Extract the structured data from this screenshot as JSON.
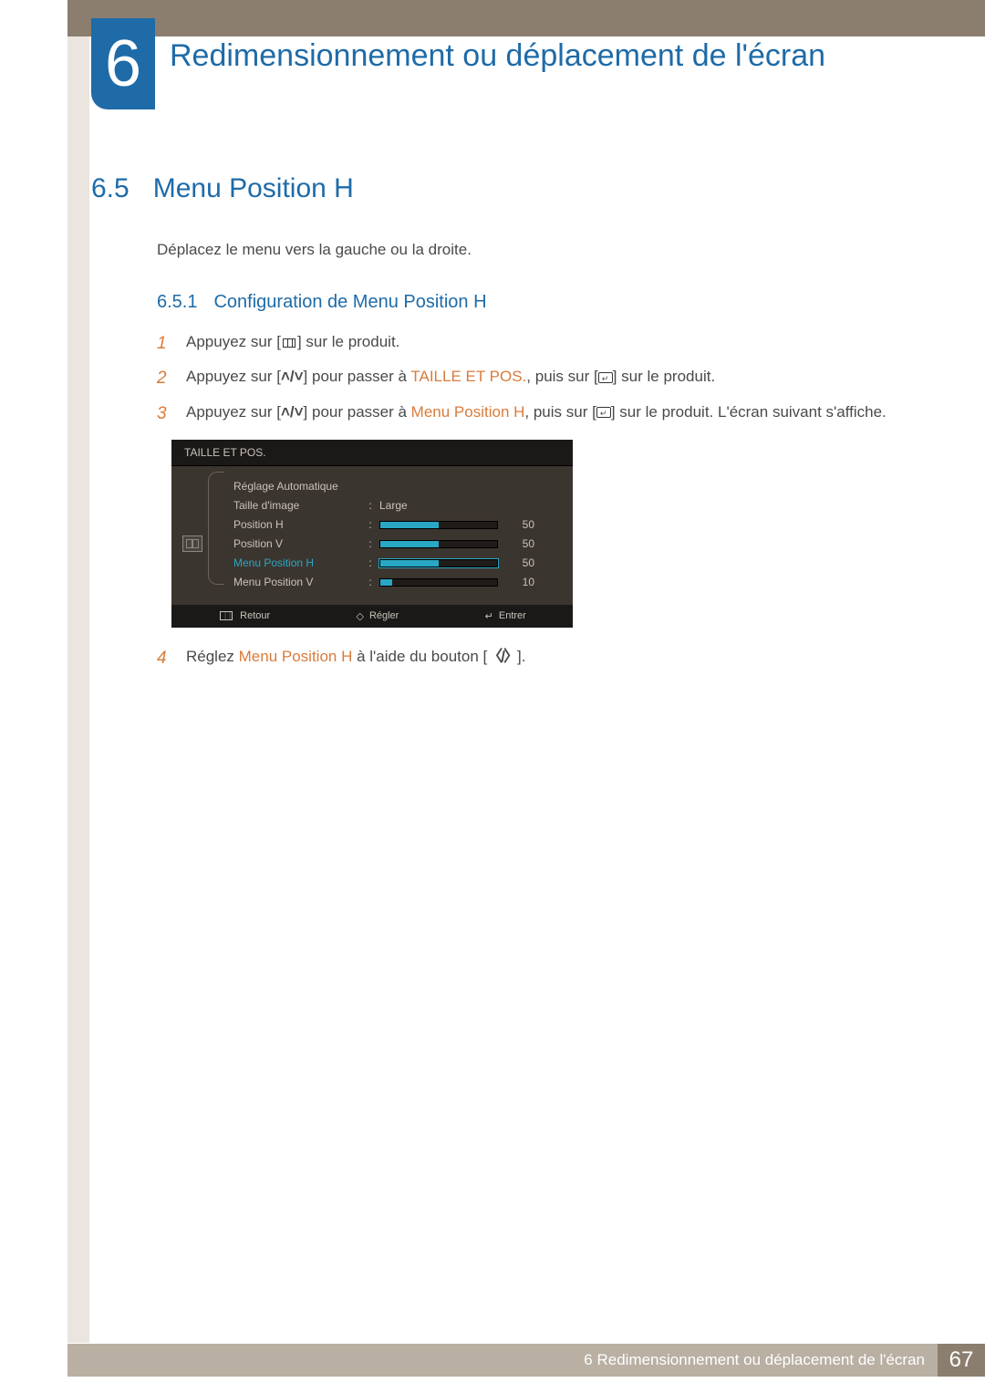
{
  "chapter": {
    "number": "6",
    "title": "Redimensionnement ou déplacement de l'écran"
  },
  "section": {
    "number": "6.5",
    "title": "Menu Position H"
  },
  "intro": "Déplacez le menu vers la gauche ou la droite.",
  "subsection": {
    "number": "6.5.1",
    "title": "Configuration de Menu Position H"
  },
  "steps": {
    "s1": {
      "num": "1",
      "a": "Appuyez sur [",
      "b": "] sur le produit."
    },
    "s2": {
      "num": "2",
      "a": "Appuyez sur [",
      "b": "] pour passer à ",
      "hl": "TAILLE ET POS.",
      "c": ", puis sur [",
      "d": "] sur le produit."
    },
    "s3": {
      "num": "3",
      "a": "Appuyez sur [",
      "b": "] pour passer à ",
      "hl": "Menu Position H",
      "c": ", puis sur [",
      "d": "] sur le produit. L'écran suivant s'affiche."
    },
    "s4": {
      "num": "4",
      "a": "Réglez ",
      "hl": "Menu Position H",
      "b": " à l'aide du bouton [",
      "c": "]."
    }
  },
  "osd": {
    "title": "TAILLE ET POS.",
    "rows": {
      "auto": {
        "label": "Réglage Automatique"
      },
      "size": {
        "label": "Taille d'image",
        "value": "Large"
      },
      "posh": {
        "label": "Position H",
        "value": "50",
        "fill": 50
      },
      "posv": {
        "label": "Position V",
        "value": "50",
        "fill": 50
      },
      "menuh": {
        "label": "Menu Position H",
        "value": "50",
        "fill": 50
      },
      "menuv": {
        "label": "Menu Position V",
        "value": "10",
        "fill": 10
      }
    },
    "footer": {
      "back": "Retour",
      "adjust": "Régler",
      "enter": "Entrer"
    }
  },
  "footer": {
    "label": "6 Redimensionnement ou déplacement de l'écran",
    "page": "67"
  }
}
